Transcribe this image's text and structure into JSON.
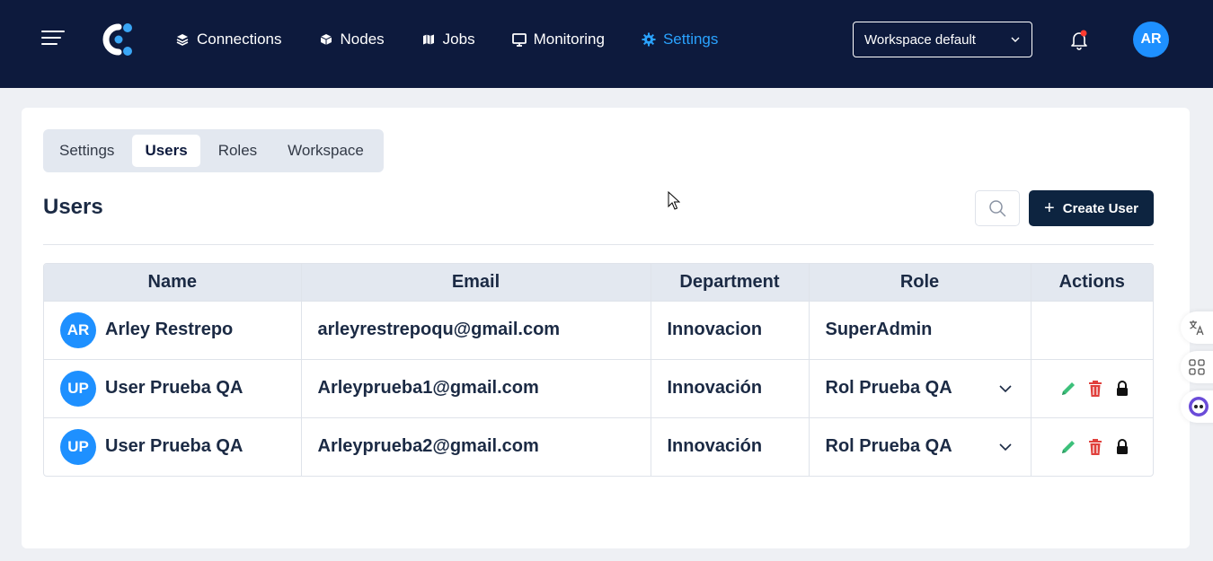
{
  "header": {
    "nav": [
      {
        "label": "Connections",
        "icon": "layers-icon",
        "active": false
      },
      {
        "label": "Nodes",
        "icon": "cube-icon",
        "active": false
      },
      {
        "label": "Jobs",
        "icon": "map-icon",
        "active": false
      },
      {
        "label": "Monitoring",
        "icon": "monitor-icon",
        "active": false
      },
      {
        "label": "Settings",
        "icon": "gear-icon",
        "active": true
      }
    ],
    "workspace_select": "Workspace default",
    "user_initials": "AR"
  },
  "tabs": [
    {
      "label": "Settings",
      "active": false
    },
    {
      "label": "Users",
      "active": true
    },
    {
      "label": "Roles",
      "active": false
    },
    {
      "label": "Workspace",
      "active": false
    }
  ],
  "page": {
    "title": "Users",
    "create_button": "Create User"
  },
  "table": {
    "columns": [
      "Name",
      "Email",
      "Department",
      "Role",
      "Actions"
    ],
    "rows": [
      {
        "initials": "AR",
        "name": "Arley Restrepo",
        "email": "arleyrestrepoqu@gmail.com",
        "department": "Innovacion",
        "role": "SuperAdmin",
        "editable": false
      },
      {
        "initials": "UP",
        "name": "User Prueba QA",
        "email": "Arleyprueba1@gmail.com",
        "department": "Innovación",
        "role": "Rol Prueba QA",
        "editable": true
      },
      {
        "initials": "UP",
        "name": "User Prueba QA",
        "email": "Arleyprueba2@gmail.com",
        "department": "Innovación",
        "role": "Rol Prueba QA",
        "editable": true
      }
    ]
  },
  "colors": {
    "topbar": "#0d1a3d",
    "accent": "#2aa3ff",
    "avatar": "#1e90ff",
    "edit": "#3cc07a",
    "delete": "#e0403c"
  }
}
